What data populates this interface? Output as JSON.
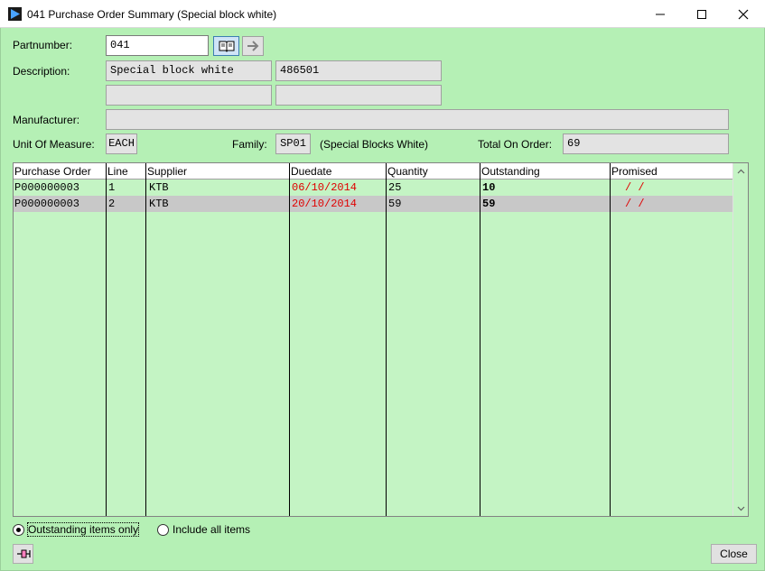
{
  "window": {
    "title": "041 Purchase Order Summary (Special block white)"
  },
  "form": {
    "partnumber_label": "Partnumber:",
    "partnumber_value": "041",
    "description_label": "Description:",
    "description_value": "Special block white",
    "description_code": "486501",
    "description_line2a": "",
    "description_line2b": "",
    "manufacturer_label": "Manufacturer:",
    "manufacturer_value": "",
    "uom_label": "Unit Of Measure:",
    "uom_value": "EACH",
    "family_label": "Family:",
    "family_value": "SP01",
    "family_desc": "(Special Blocks White)",
    "total_label": "Total On Order:",
    "total_value": "69"
  },
  "grid": {
    "headers": [
      "Purchase Order",
      "Line",
      "Supplier",
      "Duedate",
      "Quantity",
      "Outstanding",
      "Promised"
    ],
    "rows": [
      {
        "po": "P000000003",
        "line": "1",
        "supplier": "KTB",
        "duedate": "06/10/2014",
        "quantity": "25",
        "outstanding": "10",
        "promised": "/  /"
      },
      {
        "po": "P000000003",
        "line": "2",
        "supplier": "KTB",
        "duedate": "20/10/2014",
        "quantity": "59",
        "outstanding": "59",
        "promised": "/  /"
      }
    ]
  },
  "filter": {
    "outstanding_label": "Outstanding items only",
    "all_label": "Include all items",
    "selected": "outstanding"
  },
  "footer": {
    "close_label": "Close"
  },
  "icons": {
    "app": "play-icon",
    "lookup": "book-icon",
    "go": "arrow-right-icon",
    "pin": "pin-icon"
  },
  "colors": {
    "background": "#b5f0b5",
    "grid_background": "#c4f4c4",
    "duedate": "#e00000",
    "selected_row": "#c8c8c8"
  }
}
